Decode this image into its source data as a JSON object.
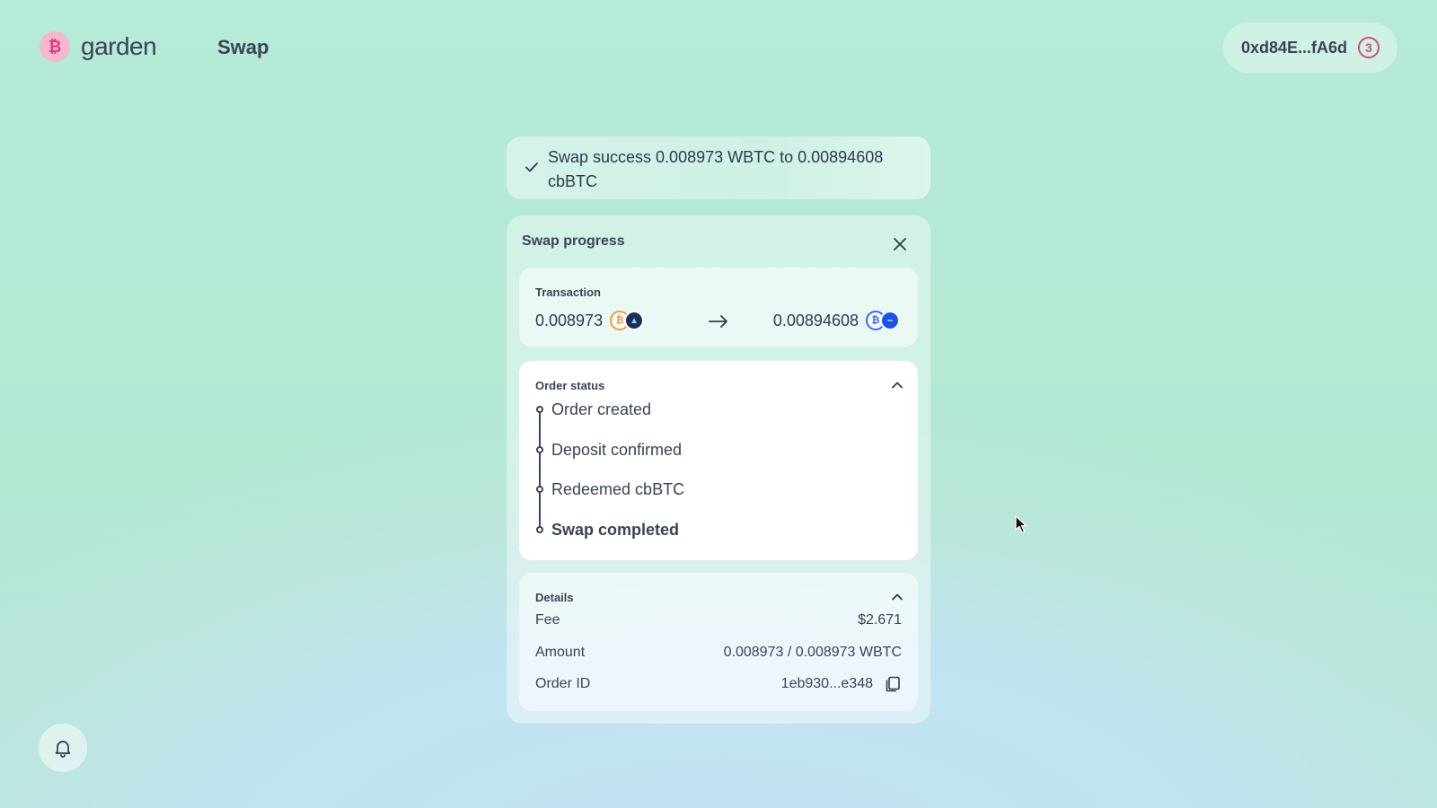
{
  "header": {
    "logo_text": "garden",
    "logo_icon": "bitcoin-b-icon",
    "nav_item": "Swap",
    "wallet_address": "0xd84E...fA6d",
    "wallet_count": "3"
  },
  "toast": {
    "message": "Swap success 0.008973 WBTC to 0.00894608 cbBTC",
    "icon": "check-icon"
  },
  "panel": {
    "title": "Swap progress",
    "transaction": {
      "label": "Transaction",
      "from_amount": "0.008973",
      "from_token_icon": "btc-token-icon",
      "from_token_letter": "₿",
      "from_chain_icon": "chain-icon",
      "to_amount": "0.00894608",
      "to_token_icon": "cbbtc-token-icon",
      "to_token_letter": "₿",
      "to_chain_icon": "base-chain-icon"
    },
    "order_status": {
      "label": "Order status",
      "steps": [
        "Order created",
        "Deposit confirmed",
        "Redeemed cbBTC",
        "Swap completed"
      ]
    },
    "details": {
      "label": "Details",
      "fee_label": "Fee",
      "fee_value": "$2.671",
      "amount_label": "Amount",
      "amount_value": "0.008973 / 0.008973 WBTC",
      "order_id_label": "Order ID",
      "order_id_value": "1eb930...e348"
    }
  },
  "colors": {
    "background": "#b6ead6",
    "accent_pink": "#e4357a",
    "text_dark": "#3a4358",
    "btc_orange": "#f09a3e",
    "cbbtc_blue": "#2f6df6"
  }
}
